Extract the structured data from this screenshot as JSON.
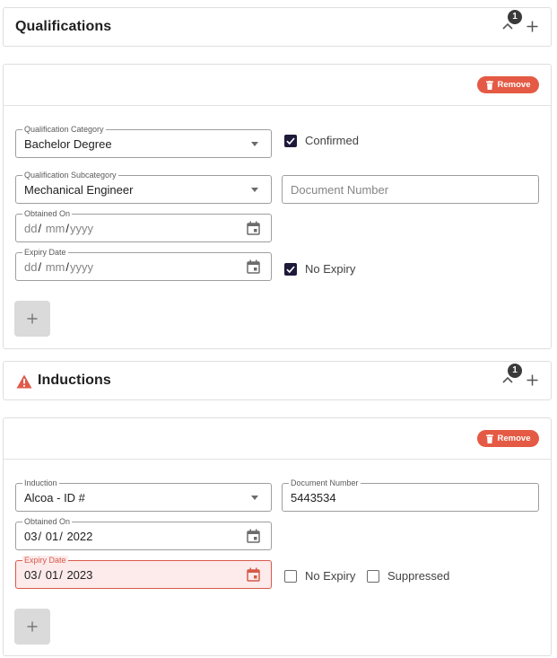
{
  "qualifications": {
    "title": "Qualifications",
    "badge_count": "1",
    "remove_label": "Remove",
    "category": {
      "label": "Qualification Category",
      "value": "Bachelor Degree"
    },
    "confirmed": {
      "label": "Confirmed",
      "checked": true
    },
    "subcategory": {
      "label": "Qualification Subcategory",
      "value": "Mechanical Engineer"
    },
    "document_number": {
      "placeholder": "Document Number"
    },
    "obtained_on": {
      "label": "Obtained On",
      "dd": "dd",
      "mm": "mm",
      "yyyy": "yyyy"
    },
    "expiry_date": {
      "label": "Expiry Date",
      "dd": "dd",
      "mm": "mm",
      "yyyy": "yyyy"
    },
    "no_expiry": {
      "label": "No Expiry",
      "checked": true
    }
  },
  "inductions": {
    "title": "Inductions",
    "badge_count": "1",
    "remove_label": "Remove",
    "induction": {
      "label": "Induction",
      "value": "Alcoa - ID #"
    },
    "document_number": {
      "label": "Document Number",
      "value": "5443534"
    },
    "obtained_on": {
      "label": "Obtained On",
      "dd": "03",
      "mm": "01",
      "yyyy": "2022"
    },
    "expiry_date": {
      "label": "Expiry Date",
      "dd": "03",
      "mm": "01",
      "yyyy": "2023",
      "state": "error"
    },
    "no_expiry": {
      "label": "No Expiry",
      "checked": false
    },
    "suppressed": {
      "label": "Suppressed",
      "checked": false
    }
  },
  "icons": {
    "collapse": "chevron-up-icon",
    "expand": "plus-icon",
    "warning": "warning-icon",
    "remove": "trash-icon",
    "calendar": "calendar-icon",
    "dropdown": "caret-down-icon",
    "add": "plus-icon"
  },
  "colors": {
    "remove_button": "#e45a44",
    "warning": "#e05a4a",
    "checkbox_checked": "#1d1a3a",
    "error_field_bg": "#fdeaea",
    "error_field_border": "#d65a4a",
    "add_button": "#dadada",
    "badge": "#3a3a3a"
  }
}
